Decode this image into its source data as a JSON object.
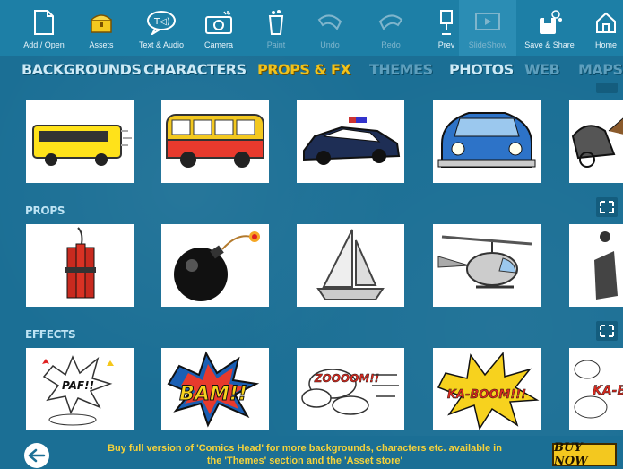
{
  "toolbar": {
    "items": [
      {
        "label": "Add / Open",
        "icon": "document-icon"
      },
      {
        "label": "Assets",
        "icon": "treasure-chest-icon"
      },
      {
        "label": "Text & Audio",
        "icon": "speech-bubble-icon"
      },
      {
        "label": "Camera",
        "icon": "camera-icon"
      },
      {
        "label": "Paint",
        "icon": "paint-bucket-icon"
      },
      {
        "label": "Undo",
        "icon": "undo-icon"
      },
      {
        "label": "Redo",
        "icon": "redo-icon"
      },
      {
        "label": "Prev",
        "icon": "preview-icon"
      },
      {
        "label": "SlideShow",
        "icon": "slideshow-icon"
      },
      {
        "label": "Save & Share",
        "icon": "save-share-icon"
      },
      {
        "label": "Home",
        "icon": "home-icon"
      }
    ]
  },
  "tabs": [
    {
      "label": "BACKGROUNDS"
    },
    {
      "label": "CHARACTERS"
    },
    {
      "label": "PROPS & FX"
    },
    {
      "label": "THEMES"
    },
    {
      "label": "PHOTOS"
    },
    {
      "label": "WEB"
    },
    {
      "label": "MAPS"
    }
  ],
  "sections": {
    "props": {
      "title": "PROPS"
    },
    "effects": {
      "title": "EFFECTS"
    }
  },
  "effects_text": {
    "paf": "PAF!!",
    "bam": "BAM!!",
    "zoom": "ZOOOOM!!",
    "kaboom": "KA-BOOM!!!",
    "kab": "KA-B"
  },
  "footer": {
    "message_line1": "Buy full version of 'Comics Head' for more backgrounds, characters etc. available in",
    "message_line2": "the 'Themes' section and the 'Asset store'",
    "buy_label": "BUY NOW"
  },
  "colors": {
    "background": "#1b6f95",
    "toolbar": "#1d7fa6",
    "active_tab": "#f1c21b",
    "buy_button": "#f3c81f"
  }
}
